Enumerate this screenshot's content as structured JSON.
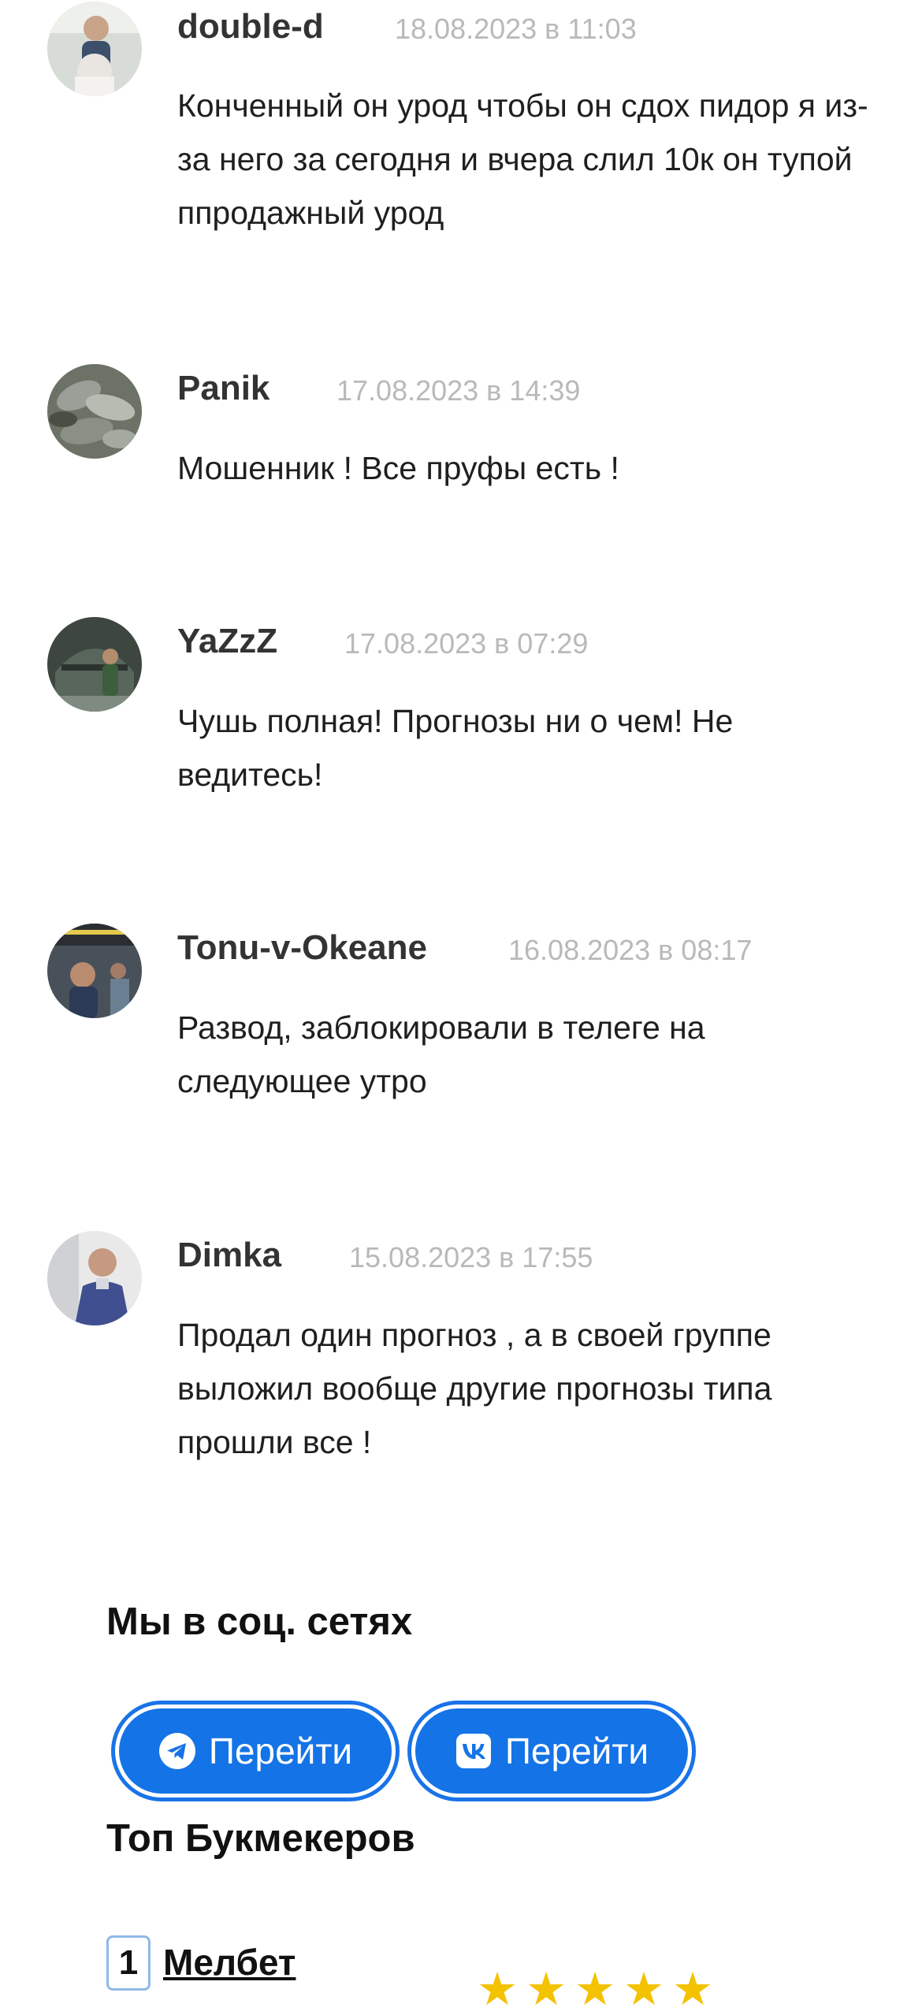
{
  "comments": [
    {
      "author": "double-d",
      "date": "18.08.2023 в 11:03",
      "text": "Конченный он урод чтобы он сдох пидор я из-за него за сегодня и вчера слил 10к он тупой ппродажный урод"
    },
    {
      "author": "Panik",
      "date": "17.08.2023 в 14:39",
      "text": "Мошенник ! Все пруфы есть !"
    },
    {
      "author": "YaZzZ",
      "date": "17.08.2023 в 07:29",
      "text": "Чушь полная! Прогнозы ни о чем! Не ведитесь!"
    },
    {
      "author": "Tonu-v-Okeane",
      "date": "16.08.2023 в 08:17",
      "text": "Развод, заблокировали в телеге на следующее утро"
    },
    {
      "author": "Dimka",
      "date": "15.08.2023 в 17:55",
      "text": "Продал один прогноз , а в своей группе выложил вообще другие прогнозы типа прошли все !"
    }
  ],
  "social": {
    "title": "Мы в соц. сетях",
    "telegram": {
      "label": "Перейти",
      "icon": "telegram-icon"
    },
    "vk": {
      "label": "Перейти",
      "icon": "vk-icon"
    },
    "accent": "#1473e6"
  },
  "bookmakers": {
    "title": "Топ Букмекеров",
    "items": [
      {
        "rank": "1",
        "name": "Мелбет",
        "rating": 5
      }
    ]
  }
}
